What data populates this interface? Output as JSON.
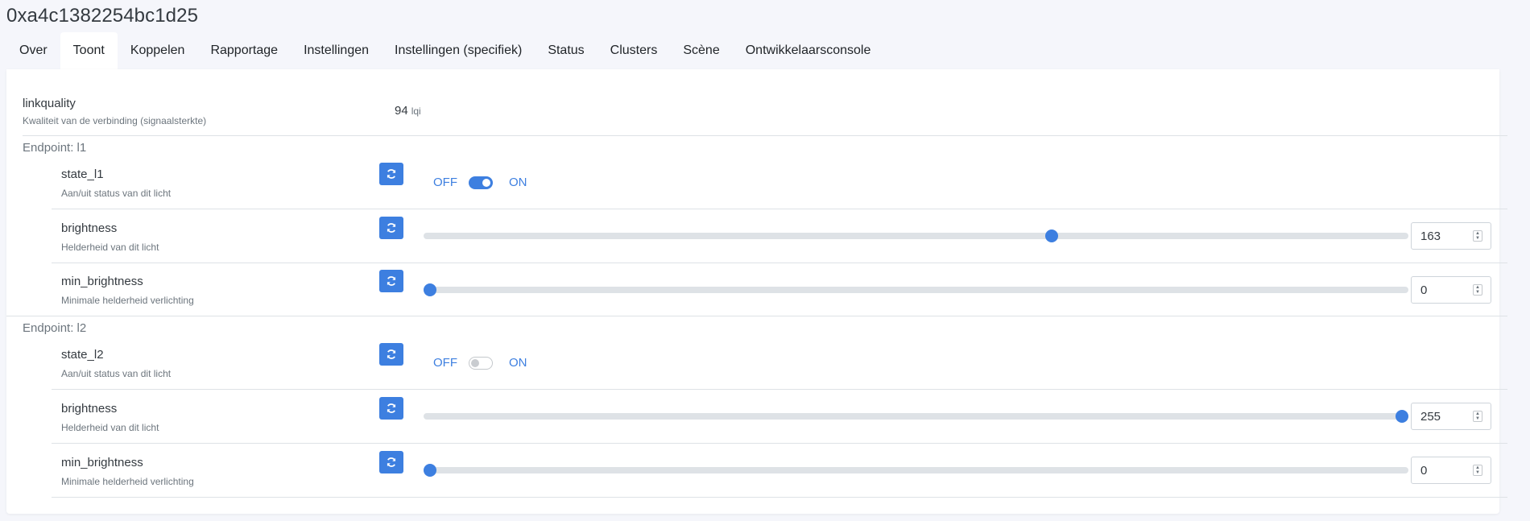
{
  "device": {
    "title": "0xa4c1382254bc1d25"
  },
  "tabs": [
    {
      "label": "Over"
    },
    {
      "label": "Toont",
      "active": true
    },
    {
      "label": "Koppelen"
    },
    {
      "label": "Rapportage"
    },
    {
      "label": "Instellingen"
    },
    {
      "label": "Instellingen (specifiek)"
    },
    {
      "label": "Status"
    },
    {
      "label": "Clusters"
    },
    {
      "label": "Scène"
    },
    {
      "label": "Ontwikkelaarsconsole"
    }
  ],
  "linkquality": {
    "name": "linkquality",
    "description": "Kwaliteit van de verbinding (signaalsterkte)",
    "value": "94",
    "unit": "lqi"
  },
  "endpoints": [
    {
      "label": "Endpoint: l1",
      "state": {
        "name": "state_l1",
        "description": "Aan/uit status van dit licht",
        "off_label": "OFF",
        "on_label": "ON",
        "is_on": true
      },
      "brightness": {
        "name": "brightness",
        "description": "Helderheid van dit licht",
        "value": "163",
        "min": 0,
        "max": 255
      },
      "min_brightness": {
        "name": "min_brightness",
        "description": "Minimale helderheid verlichting",
        "value": "0",
        "min": 0,
        "max": 255
      }
    },
    {
      "label": "Endpoint: l2",
      "state": {
        "name": "state_l2",
        "description": "Aan/uit status van dit licht",
        "off_label": "OFF",
        "on_label": "ON",
        "is_on": false
      },
      "brightness": {
        "name": "brightness",
        "description": "Helderheid van dit licht",
        "value": "255",
        "min": 0,
        "max": 255
      },
      "min_brightness": {
        "name": "min_brightness",
        "description": "Minimale helderheid verlichting",
        "value": "0",
        "min": 0,
        "max": 255
      }
    }
  ],
  "icons": {
    "refresh": "refresh-icon",
    "spinner": "number-spinner-icon"
  },
  "colors": {
    "accent": "#3d7fe0",
    "page_background": "#f5f6fb",
    "track": "#dee2e6"
  }
}
